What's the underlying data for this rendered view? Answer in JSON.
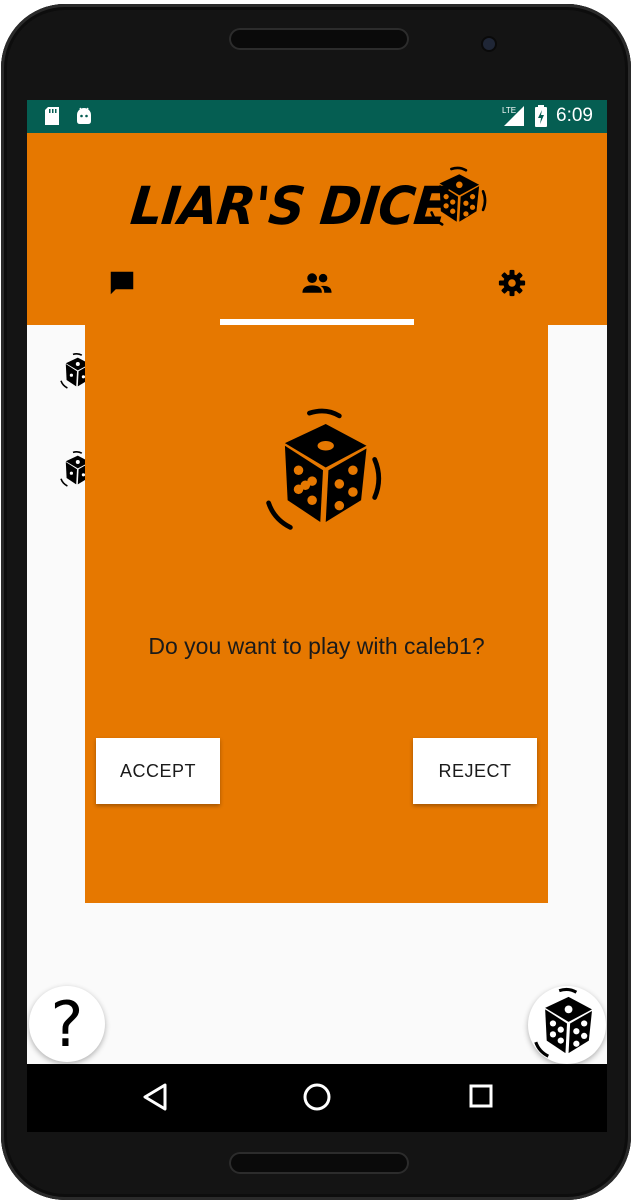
{
  "status_bar": {
    "time": "6:09",
    "network": "LTE",
    "icons": [
      "sd-card-icon",
      "android-icon",
      "lte-signal-icon",
      "battery-charging-icon"
    ]
  },
  "app": {
    "title": "LIAR'S DICE",
    "brand_color": "#e67800",
    "status_color": "#055e52"
  },
  "tabs": [
    {
      "name": "chat",
      "icon": "chat-icon",
      "selected": false
    },
    {
      "name": "friends",
      "icon": "people-icon",
      "selected": true
    },
    {
      "name": "settings",
      "icon": "gear-icon",
      "selected": false
    }
  ],
  "dialog": {
    "message": "Do you want to play with caleb1?",
    "accept_label": "ACCEPT",
    "reject_label": "REJECT"
  },
  "fab": {
    "help_label": "?"
  },
  "nav": [
    "back-icon",
    "home-icon",
    "recents-icon"
  ]
}
